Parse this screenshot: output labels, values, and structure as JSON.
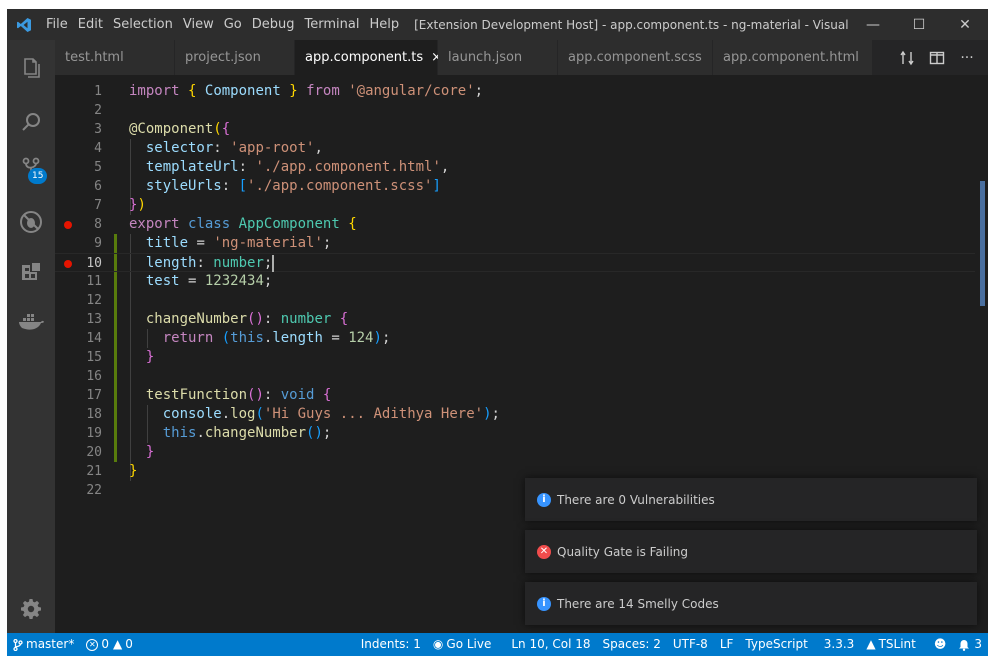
{
  "titlebar": {
    "menu": [
      "File",
      "Edit",
      "Selection",
      "View",
      "Go",
      "Debug",
      "Terminal",
      "Help"
    ],
    "title": "[Extension Development Host] - app.component.ts - ng-material - Visual Stud...",
    "minimize": "—",
    "maximize": "☐",
    "close": "✕"
  },
  "activitybar": {
    "items": [
      "explorer-icon",
      "search-icon",
      "source-control-icon",
      "debug-icon",
      "extensions-icon",
      "docker-icon"
    ],
    "scm_badge": "15",
    "settings": "gear-icon"
  },
  "tabs": [
    {
      "label": "test.html",
      "active": false
    },
    {
      "label": "project.json",
      "active": false
    },
    {
      "label": "app.component.ts",
      "active": true,
      "close": "×"
    },
    {
      "label": "launch.json",
      "active": false
    },
    {
      "label": "app.component.scss",
      "active": false
    },
    {
      "label": "app.component.html",
      "active": false
    }
  ],
  "tab_actions": {
    "compare": "compare-icon",
    "split": "split-editor-icon",
    "more": "···"
  },
  "editor": {
    "current_line": 10,
    "breakpoint_lines": [
      8,
      10
    ],
    "line_numbers": [
      "1",
      "2",
      "3",
      "4",
      "5",
      "6",
      "7",
      "8",
      "9",
      "10",
      "11",
      "12",
      "13",
      "14",
      "15",
      "16",
      "17",
      "18",
      "19",
      "20",
      "21",
      "22"
    ],
    "lines": [
      [
        [
          "k",
          "import"
        ],
        [
          "p",
          " "
        ],
        [
          "br1",
          "{"
        ],
        [
          "p",
          " "
        ],
        [
          "v",
          "Component"
        ],
        [
          "p",
          " "
        ],
        [
          "br1",
          "}"
        ],
        [
          "p",
          " "
        ],
        [
          "k",
          "from"
        ],
        [
          "p",
          " "
        ],
        [
          "s",
          "'@angular/core'"
        ],
        [
          "p",
          ";"
        ]
      ],
      [],
      [
        [
          "f",
          "@Component"
        ],
        [
          "br1",
          "("
        ],
        [
          "br2",
          "{"
        ]
      ],
      [
        [
          "p",
          "  "
        ],
        [
          "v",
          "selector"
        ],
        [
          "p",
          ": "
        ],
        [
          "s",
          "'app-root'"
        ],
        [
          "p",
          ","
        ]
      ],
      [
        [
          "p",
          "  "
        ],
        [
          "v",
          "templateUrl"
        ],
        [
          "p",
          ": "
        ],
        [
          "s",
          "'./app.component.html'"
        ],
        [
          "p",
          ","
        ]
      ],
      [
        [
          "p",
          "  "
        ],
        [
          "v",
          "styleUrls"
        ],
        [
          "p",
          ": "
        ],
        [
          "br3",
          "["
        ],
        [
          "s",
          "'./app.component.scss'"
        ],
        [
          "br3",
          "]"
        ]
      ],
      [
        [
          "br2",
          "}"
        ],
        [
          "br1",
          ")"
        ]
      ],
      [
        [
          "k",
          "export"
        ],
        [
          "p",
          " "
        ],
        [
          "kb",
          "class"
        ],
        [
          "p",
          " "
        ],
        [
          "t",
          "AppComponent"
        ],
        [
          "p",
          " "
        ],
        [
          "br1",
          "{"
        ]
      ],
      [
        [
          "p",
          "  "
        ],
        [
          "v",
          "title"
        ],
        [
          "p",
          " = "
        ],
        [
          "s",
          "'ng-material'"
        ],
        [
          "p",
          ";"
        ]
      ],
      [
        [
          "p",
          "  "
        ],
        [
          "v",
          "length"
        ],
        [
          "p",
          ": "
        ],
        [
          "t",
          "number"
        ],
        [
          "p",
          ";"
        ]
      ],
      [
        [
          "p",
          "  "
        ],
        [
          "v",
          "test"
        ],
        [
          "p",
          " = "
        ],
        [
          "n",
          "1232434"
        ],
        [
          "p",
          ";"
        ]
      ],
      [],
      [
        [
          "p",
          "  "
        ],
        [
          "f",
          "changeNumber"
        ],
        [
          "br2",
          "("
        ],
        [
          "br2",
          ")"
        ],
        [
          "p",
          ": "
        ],
        [
          "t",
          "number"
        ],
        [
          "p",
          " "
        ],
        [
          "br2",
          "{"
        ]
      ],
      [
        [
          "p",
          "    "
        ],
        [
          "k",
          "return"
        ],
        [
          "p",
          " "
        ],
        [
          "br3",
          "("
        ],
        [
          "kb",
          "this"
        ],
        [
          "p",
          "."
        ],
        [
          "v",
          "length"
        ],
        [
          "p",
          " = "
        ],
        [
          "n",
          "124"
        ],
        [
          "br3",
          ")"
        ],
        [
          "p",
          ";"
        ]
      ],
      [
        [
          "p",
          "  "
        ],
        [
          "br2",
          "}"
        ]
      ],
      [],
      [
        [
          "p",
          "  "
        ],
        [
          "f",
          "testFunction"
        ],
        [
          "br2",
          "("
        ],
        [
          "br2",
          ")"
        ],
        [
          "p",
          ": "
        ],
        [
          "kb",
          "void"
        ],
        [
          "p",
          " "
        ],
        [
          "br2",
          "{"
        ]
      ],
      [
        [
          "p",
          "    "
        ],
        [
          "v",
          "console"
        ],
        [
          "p",
          "."
        ],
        [
          "f",
          "log"
        ],
        [
          "br3",
          "("
        ],
        [
          "s",
          "'Hi Guys ... Adithya Here'"
        ],
        [
          "br3",
          ")"
        ],
        [
          "p",
          ";"
        ]
      ],
      [
        [
          "p",
          "    "
        ],
        [
          "kb",
          "this"
        ],
        [
          "p",
          "."
        ],
        [
          "f",
          "changeNumber"
        ],
        [
          "br3",
          "("
        ],
        [
          "br3",
          ")"
        ],
        [
          "p",
          ";"
        ]
      ],
      [
        [
          "p",
          "  "
        ],
        [
          "br2",
          "}"
        ]
      ],
      [
        [
          "br1",
          "}"
        ]
      ],
      []
    ]
  },
  "notifications": [
    {
      "type": "info",
      "icon": "info-icon",
      "text": "There are 0 Vulnerabilities"
    },
    {
      "type": "error",
      "icon": "error-icon",
      "text": "Quality Gate is Failing"
    },
    {
      "type": "info",
      "icon": "info-icon",
      "text": "There are 14 Smelly Codes"
    }
  ],
  "statusbar": {
    "branch": "master*",
    "errors": "0",
    "warnings": "0",
    "indents": "Indents: 1",
    "golive": "Go Live",
    "position": "Ln 10, Col 18",
    "spaces": "Spaces: 2",
    "encoding": "UTF-8",
    "eol": "LF",
    "language": "TypeScript",
    "version": "3.3.3",
    "tslint": "TSLint",
    "notifications_count": "3"
  },
  "colors": {
    "accent": "#007acc",
    "breakpoint": "#e51400",
    "git_modified": "#587c0c"
  }
}
